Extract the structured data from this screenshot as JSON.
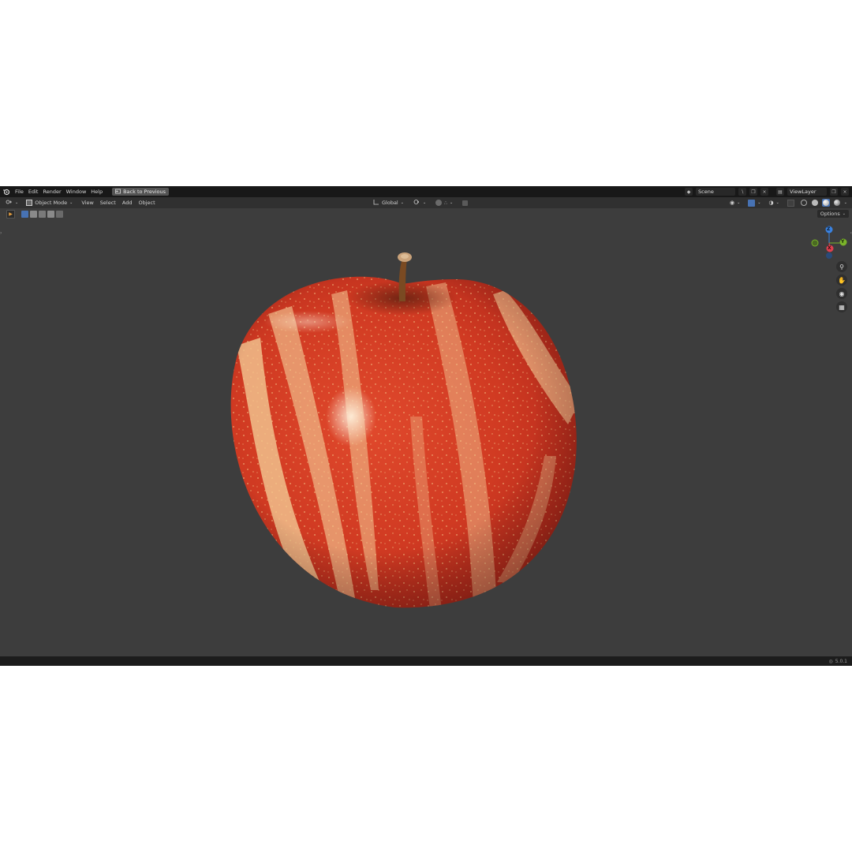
{
  "topbar": {
    "menus": [
      "File",
      "Edit",
      "Render",
      "Window",
      "Help"
    ],
    "back_button": "Back to Previous",
    "scene": "Scene",
    "view_layer": "ViewLayer"
  },
  "header": {
    "mode": "Object Mode",
    "menus": [
      "View",
      "Select",
      "Add",
      "Object"
    ],
    "transform_orientation": "Global"
  },
  "toolrow": {
    "options": "Options"
  },
  "gizmo": {
    "z": "Z",
    "y": "Y",
    "x": "X"
  },
  "statusbar": {
    "version": "5.0.1"
  },
  "colors": {
    "background": "#3d3d3d",
    "topbar": "#181818",
    "header": "#303030",
    "axis_x": "#e0404f",
    "axis_y": "#7ab32a",
    "axis_z": "#3a82e0",
    "apple_red": "#d23a22",
    "apple_cream": "#efb887"
  },
  "icons": [
    "blender-logo-icon",
    "back-arrow-icon",
    "editor-type-icon",
    "object-mode-icon",
    "zoom-icon",
    "hand-pan-icon",
    "camera-icon",
    "grid-ortho-icon",
    "globe-icon"
  ]
}
